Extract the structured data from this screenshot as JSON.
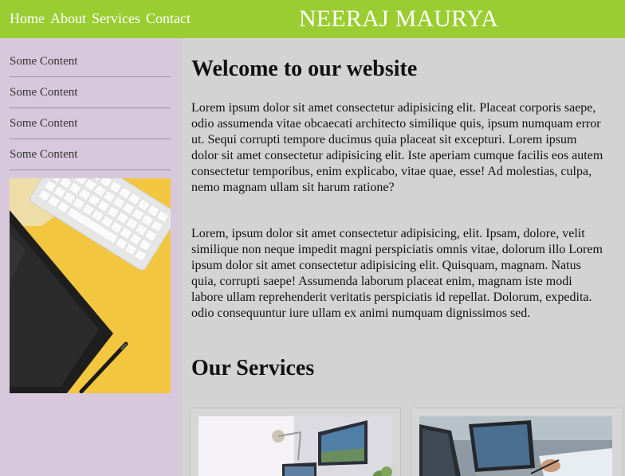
{
  "header": {
    "nav": [
      "Home",
      "About",
      "Services",
      "Contact"
    ],
    "brand": "NEERAJ MAURYA",
    "bg_color": "#9acd32"
  },
  "sidebar": {
    "items": [
      "Some Content",
      "Some Content",
      "Some Content",
      "Some Content"
    ],
    "image_icon": "desk-keyboard-tablet-photo",
    "bg_color": "#d8c8dc"
  },
  "main": {
    "welcome_title": "Welcome to our website",
    "paragraph1": "Lorem ipsum dolor sit amet consectetur adipisicing elit. Placeat corporis saepe, odio assumenda vitae obcaecati architecto similique quis, ipsum numquam error ut. Sequi corrupti tempore ducimus quia placeat sit excepturi. Lorem ipsum dolor sit amet consectetur adipisicing elit. Iste aperiam cumque facilis eos autem consectetur temporibus, enim explicabo, vitae quae, esse! Ad molestias, culpa, nemo magnam ullam sit harum ratione?",
    "paragraph2": "Lorem, ipsum dolor sit amet consectetur adipisicing, elit. Ipsam, dolore, velit similique non neque impedit magni perspiciatis omnis vitae, dolorum illo Lorem ipsum dolor sit amet consectetur adipisicing elit. Quisquam, magnam. Natus quia, corrupti saepe! Assumenda laborum placeat enim, magnam iste modi labore ullam reprehenderit veritatis perspiciatis id repellat. Dolorum, expedita. odio consequuntur iure ullam ex animi numquam dignissimos sed.",
    "services_title": "Our Services",
    "bg_color": "#d3d3d3"
  },
  "services": [
    {
      "image_icon": "desk-monitor-lamp-photo"
    },
    {
      "image_icon": "laptop-hands-photo"
    }
  ]
}
